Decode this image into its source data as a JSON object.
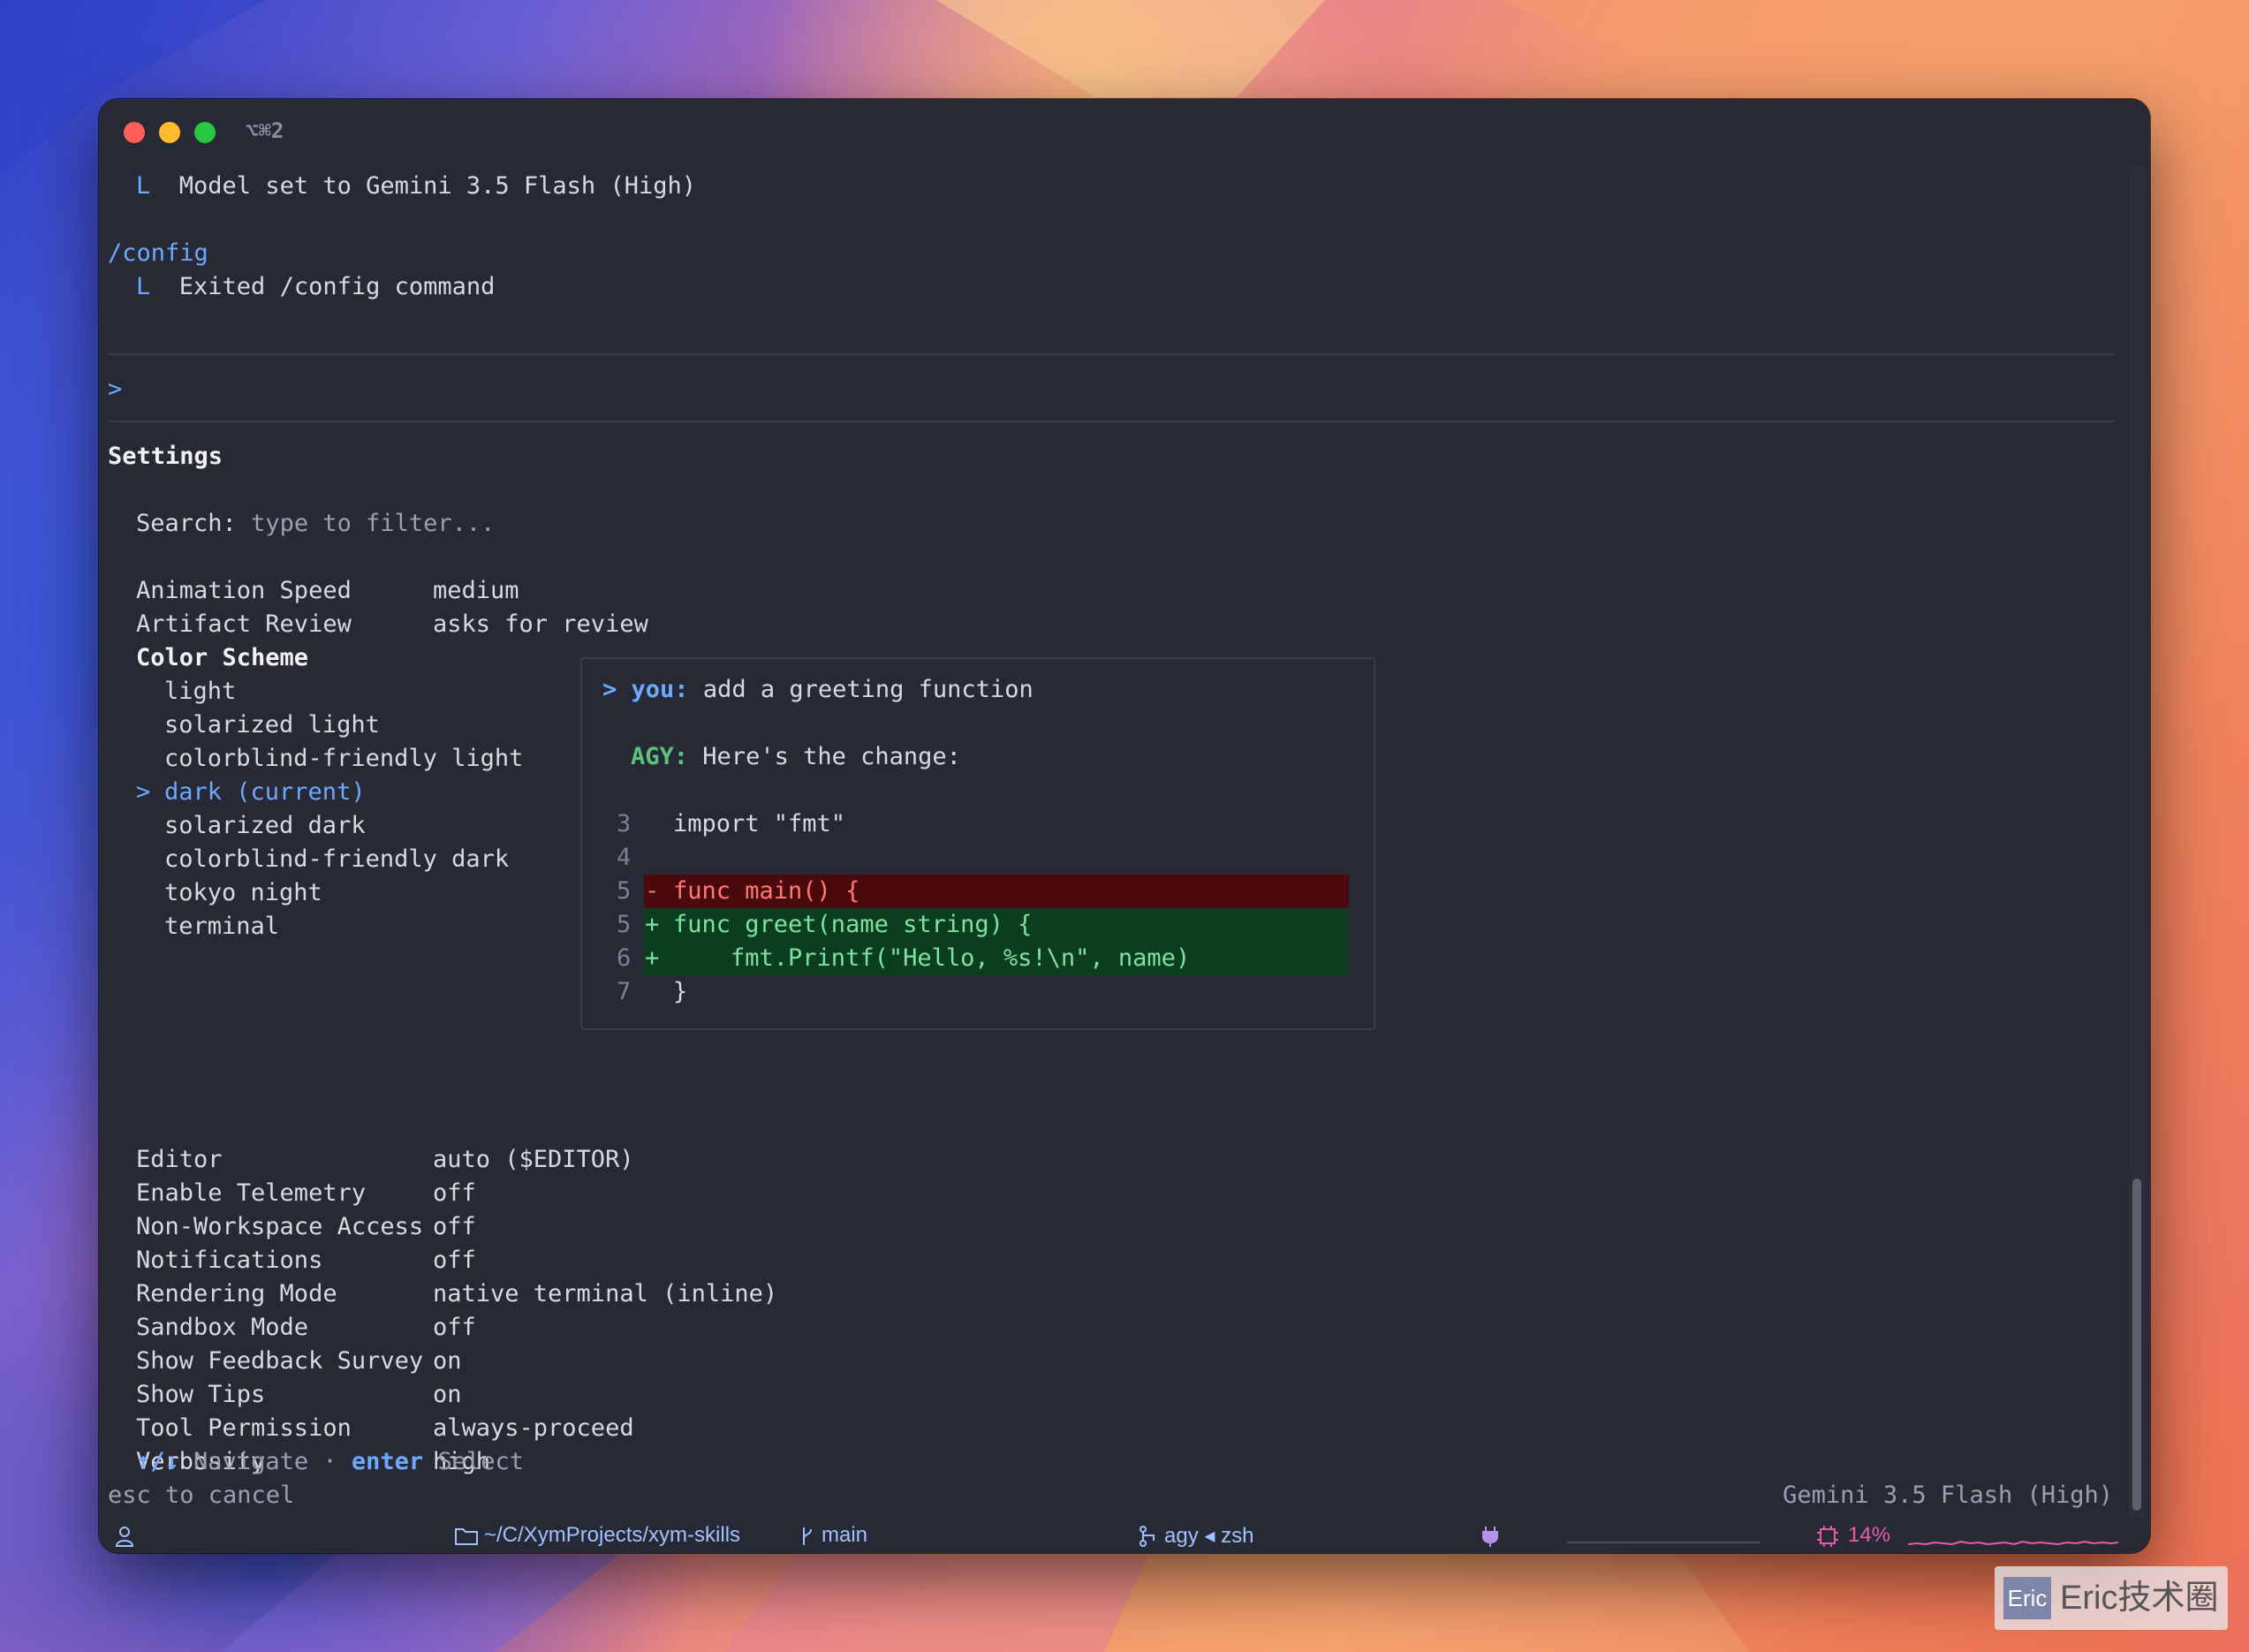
{
  "titlebar": {
    "shortcut": "⌥⌘2"
  },
  "history": {
    "model_line": "Model set to Gemini 3.5 Flash (High)",
    "tree_glyph": "L",
    "command": "/config",
    "command_result": "Exited /config command"
  },
  "prompt": {
    "symbol": ">"
  },
  "settings": {
    "title": "Settings",
    "search_label": "Search:",
    "search_placeholder": "type to filter...",
    "items_before": [
      {
        "label": "Animation Speed",
        "value": "medium"
      },
      {
        "label": "Artifact Review",
        "value": "asks for review"
      }
    ],
    "color_scheme": {
      "label": "Color Scheme",
      "options": [
        "light",
        "solarized light",
        "colorblind-friendly light",
        "dark (current)",
        "solarized dark",
        "colorblind-friendly dark",
        "tokyo night",
        "terminal"
      ],
      "selected_index": 3,
      "selected_marker": ">"
    },
    "items_after": [
      {
        "label": "Editor",
        "value": "auto ($EDITOR)"
      },
      {
        "label": "Enable Telemetry",
        "value": "off"
      },
      {
        "label": "Non-Workspace Access",
        "value": "off"
      },
      {
        "label": "Notifications",
        "value": "off"
      },
      {
        "label": "Rendering Mode",
        "value": "native terminal (inline)"
      },
      {
        "label": "Sandbox Mode",
        "value": "off"
      },
      {
        "label": "Show Feedback Survey",
        "value": "on"
      },
      {
        "label": "Show Tips",
        "value": "on"
      },
      {
        "label": "Tool Permission",
        "value": "always-proceed"
      },
      {
        "label": "Verbosity",
        "value": "high"
      }
    ]
  },
  "preview": {
    "user_prefix": ">",
    "user_label": "you:",
    "user_message": "add a greeting function",
    "agent_label": "AGY:",
    "agent_message": "Here's the change:",
    "code": [
      {
        "num": "3",
        "marker": " ",
        "text": "import \"fmt\"",
        "kind": "ctx"
      },
      {
        "num": "4",
        "marker": " ",
        "text": "",
        "kind": "ctx"
      },
      {
        "num": "5",
        "marker": "-",
        "text": "func main() {",
        "kind": "del"
      },
      {
        "num": "5",
        "marker": "+",
        "text": "func greet(name string) {",
        "kind": "add"
      },
      {
        "num": "6",
        "marker": "+",
        "text": "    fmt.Printf(\"Hello, %s!\\n\", name)",
        "kind": "add"
      },
      {
        "num": "7",
        "marker": " ",
        "text": "}",
        "kind": "ctx"
      }
    ]
  },
  "footer": {
    "nav_keys": "↑/↓",
    "nav_label": "Navigate",
    "dot": "·",
    "select_key": "enter",
    "select_label": "Select",
    "cancel_hint": "esc to cancel",
    "model": "Gemini 3.5 Flash (High)"
  },
  "statusbar": {
    "path": "~/C/XymProjects/xym-skills",
    "branch": "main",
    "session": "agy ◂ zsh",
    "cpu": "14%"
  },
  "watermark": {
    "logo": "Eric",
    "text": "Eric技术圈"
  },
  "colors": {
    "accent_blue": "#6ea8ff",
    "agent_green": "#58c47e",
    "diff_del_bg": "#4a0a0d",
    "diff_add_bg": "#0b3d1f"
  }
}
